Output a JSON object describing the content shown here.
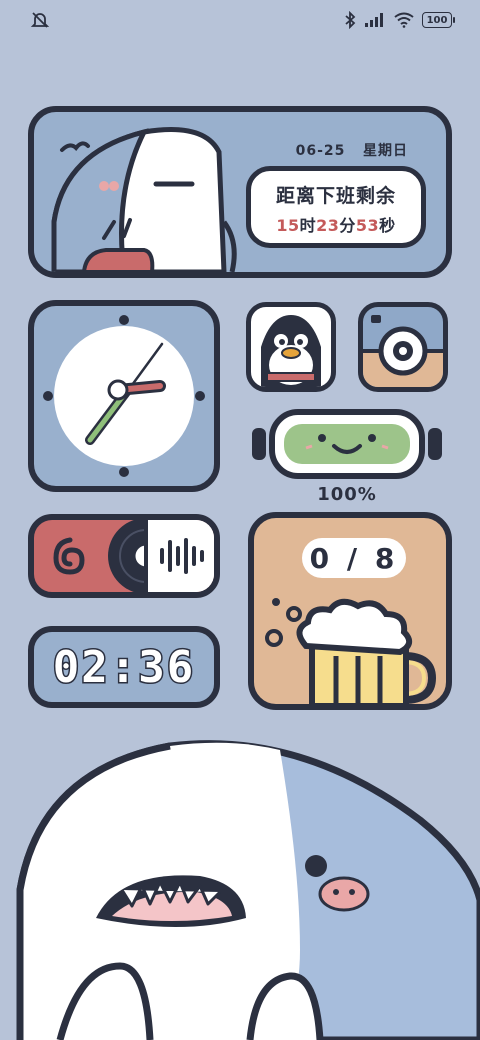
{
  "status_bar": {
    "left_icon": "muted-bell-icon",
    "right_icons": [
      "bluetooth-icon",
      "signal-icon",
      "wifi-icon"
    ],
    "battery_level": "100"
  },
  "countdown_widget": {
    "date": "06-25",
    "weekday": "星期日",
    "title": "距离下班剩余",
    "hours": "15",
    "hours_unit": "时",
    "minutes": "23",
    "minutes_unit": "分",
    "seconds": "53",
    "seconds_unit": "秒"
  },
  "apps": {
    "qq_icon": "penguin-app-icon",
    "camera_icon": "camera-app-icon"
  },
  "battery_widget": {
    "percent": "100%"
  },
  "music_widget": {
    "app_icon": "music-app-icon",
    "wave_icon": "audio-wave-icon"
  },
  "digital_clock": {
    "time": "02:36"
  },
  "beer_widget": {
    "counter": "0 / 8"
  },
  "colors": {
    "background": "#b7c3d8",
    "outline": "#2b3040",
    "accent_red": "#c45a5a",
    "card_blue": "#99b0cd",
    "card_tan": "#e0b896"
  }
}
